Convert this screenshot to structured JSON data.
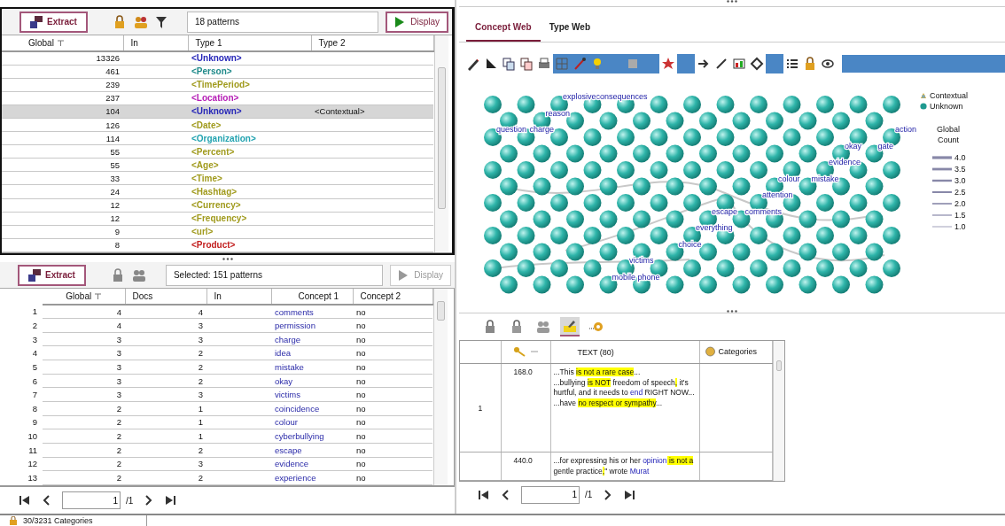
{
  "pattern_results": {
    "extract_label": "Extract",
    "summary": "18 patterns",
    "display": {
      "label": "Display",
      "disabled": false
    },
    "columns": [
      "Global",
      "In",
      "Type 1",
      "Type 2"
    ],
    "rows": [
      {
        "global": "13326",
        "type_1": "<Unknown>",
        "color": "#2626b8",
        "selected": false
      },
      {
        "global": "461",
        "type_1": "<Person>",
        "color": "#1f8a8a",
        "selected": false
      },
      {
        "global": "239",
        "type_1": "<TimePeriod>",
        "color": "#a09a1c",
        "selected": false
      },
      {
        "global": "237",
        "type_1": "<Location>",
        "color": "#b51cb5",
        "selected": false
      },
      {
        "global": "104",
        "type_1": "<Unknown>",
        "color": "#2626b8",
        "type_2": "<Contextual>",
        "selected": true
      },
      {
        "global": "126",
        "type_1": "<Date>",
        "color": "#a09a1c",
        "selected": false
      },
      {
        "global": "114",
        "type_1": "<Organization>",
        "color": "#22a3b0",
        "selected": false
      },
      {
        "global": "55",
        "type_1": "<Percent>",
        "color": "#a09a1c",
        "selected": false
      },
      {
        "global": "55",
        "type_1": "<Age>",
        "color": "#a09a1c",
        "selected": false
      },
      {
        "global": "33",
        "type_1": "<Time>",
        "color": "#a09a1c",
        "selected": false
      },
      {
        "global": "24",
        "type_1": "<Hashtag>",
        "color": "#a09a1c",
        "selected": false
      },
      {
        "global": "12",
        "type_1": "<Currency>",
        "color": "#a09a1c",
        "selected": false
      },
      {
        "global": "12",
        "type_1": "<Frequency>",
        "color": "#a09a1c",
        "selected": false
      },
      {
        "global": "9",
        "type_1": "<url>",
        "color": "#a09a1c",
        "selected": false
      },
      {
        "global": "8",
        "type_1": "<Product>",
        "color": "#c21d1d",
        "selected": false
      }
    ]
  },
  "concept_results": {
    "extract_label": "Extract",
    "summary": "Selected: 151 patterns",
    "display": {
      "label": "Display",
      "disabled": true
    },
    "columns": [
      "Global",
      "Docs",
      "In",
      "Concept 1",
      "Concept 2"
    ],
    "rows": [
      {
        "number": "1",
        "global": "4",
        "docs": "4",
        "concept_1": "comments",
        "concept_2": "no"
      },
      {
        "number": "2",
        "global": "4",
        "docs": "3",
        "concept_1": "permission",
        "concept_2": "no"
      },
      {
        "number": "3",
        "global": "3",
        "docs": "3",
        "concept_1": "charge",
        "concept_2": "no"
      },
      {
        "number": "4",
        "global": "3",
        "docs": "2",
        "concept_1": "idea",
        "concept_2": "no"
      },
      {
        "number": "5",
        "global": "3",
        "docs": "2",
        "concept_1": "mistake",
        "concept_2": "no"
      },
      {
        "number": "6",
        "global": "3",
        "docs": "2",
        "concept_1": "okay",
        "concept_2": "no"
      },
      {
        "number": "7",
        "global": "3",
        "docs": "3",
        "concept_1": "victims",
        "concept_2": "no"
      },
      {
        "number": "8",
        "global": "2",
        "docs": "1",
        "concept_1": "coincidence",
        "concept_2": "no"
      },
      {
        "number": "9",
        "global": "2",
        "docs": "1",
        "concept_1": "colour",
        "concept_2": "no"
      },
      {
        "number": "10",
        "global": "2",
        "docs": "1",
        "concept_1": "cyberbullying",
        "concept_2": "no"
      },
      {
        "number": "11",
        "global": "2",
        "docs": "2",
        "concept_1": "escape",
        "concept_2": "no"
      },
      {
        "number": "12",
        "global": "2",
        "docs": "3",
        "concept_1": "evidence",
        "concept_2": "no"
      },
      {
        "number": "13",
        "global": "2",
        "docs": "2",
        "concept_1": "experience",
        "concept_2": "no"
      }
    ],
    "pager": {
      "page": "1",
      "total": "/1"
    }
  },
  "web": {
    "tabs": [
      {
        "label": "Concept Web",
        "selected": true
      },
      {
        "label": "Type Web",
        "selected": false
      }
    ],
    "tools": [
      {
        "on": false
      },
      {
        "on": false
      },
      {
        "on": false
      },
      {
        "on": false
      },
      {
        "on": false
      },
      {
        "on": true
      },
      {
        "on": true
      },
      {
        "on": true
      },
      {
        "on": true
      },
      {
        "on": true
      },
      {
        "on": true
      },
      {
        "on": false
      },
      {
        "on": true
      },
      {
        "on": false
      },
      {
        "on": false
      },
      {
        "on": false
      },
      {
        "on": false
      },
      {
        "on": true
      },
      {
        "on": false
      },
      {
        "on": false
      },
      {
        "on": false
      }
    ],
    "node_labels": [
      "consequences",
      "charge",
      "gate",
      "mistake",
      "comments",
      "choice",
      "mobile phone",
      "reason",
      "action",
      "evidence",
      "attention",
      "everything",
      "victims",
      "explosive",
      "question",
      "okay",
      "colour",
      "escape"
    ],
    "legend": [
      {
        "label": "Contextual",
        "kind": "contextual"
      },
      {
        "label": "Unknown",
        "kind": "unknown"
      }
    ],
    "count_title": "Global Count",
    "count_ticks": [
      "4.0",
      "3.5",
      "3.0",
      "2.5",
      "2.0",
      "1.5",
      "1.0"
    ]
  },
  "snippets": {
    "tools": [
      {
        "on": false
      },
      {
        "on": false
      },
      {
        "on": false
      },
      {
        "on": true
      },
      {
        "on": false
      }
    ],
    "text_column": "TEXT (80)",
    "categories_column": "Categories",
    "rows": [
      {
        "number": "1",
        "score": "168.0",
        "lines": [
          [
            {
              "text": "...This ",
              "kind": "plain"
            },
            {
              "text": "is not a rare case",
              "kind": "match"
            },
            {
              "text": "...",
              "kind": "plain"
            }
          ],
          [
            {
              "text": "...bullying ",
              "kind": "plain"
            },
            {
              "text": "is NOT",
              "kind": "match"
            },
            {
              "text": " freedom of speech",
              "kind": "plain"
            },
            {
              "text": ",",
              "kind": "match"
            },
            {
              "text": " it's hurtful, and it needs to ",
              "kind": "plain"
            },
            {
              "text": "end",
              "kind": "concept"
            },
            {
              "text": " RIGHT NOW...",
              "kind": "plain"
            }
          ],
          [
            {
              "text": "...have ",
              "kind": "plain"
            },
            {
              "text": "no respect or sympathy",
              "kind": "match"
            },
            {
              "text": "...",
              "kind": "plain"
            }
          ]
        ]
      },
      {
        "score": "440.0",
        "lines": [
          [
            {
              "text": "...for expressing his or her ",
              "kind": "plain"
            },
            {
              "text": "opinion",
              "kind": "concept"
            },
            {
              "text": " is not a",
              "kind": "match"
            },
            {
              "text": " gentle practice",
              "kind": "plain"
            },
            {
              "text": ",",
              "kind": "match"
            },
            {
              "text": "\" wrote ",
              "kind": "plain"
            },
            {
              "text": "Murat",
              "kind": "concept"
            }
          ]
        ]
      }
    ],
    "pager": {
      "page": "1",
      "total": "/1"
    }
  },
  "status_bar": {
    "text": "30/3231 Categories"
  }
}
